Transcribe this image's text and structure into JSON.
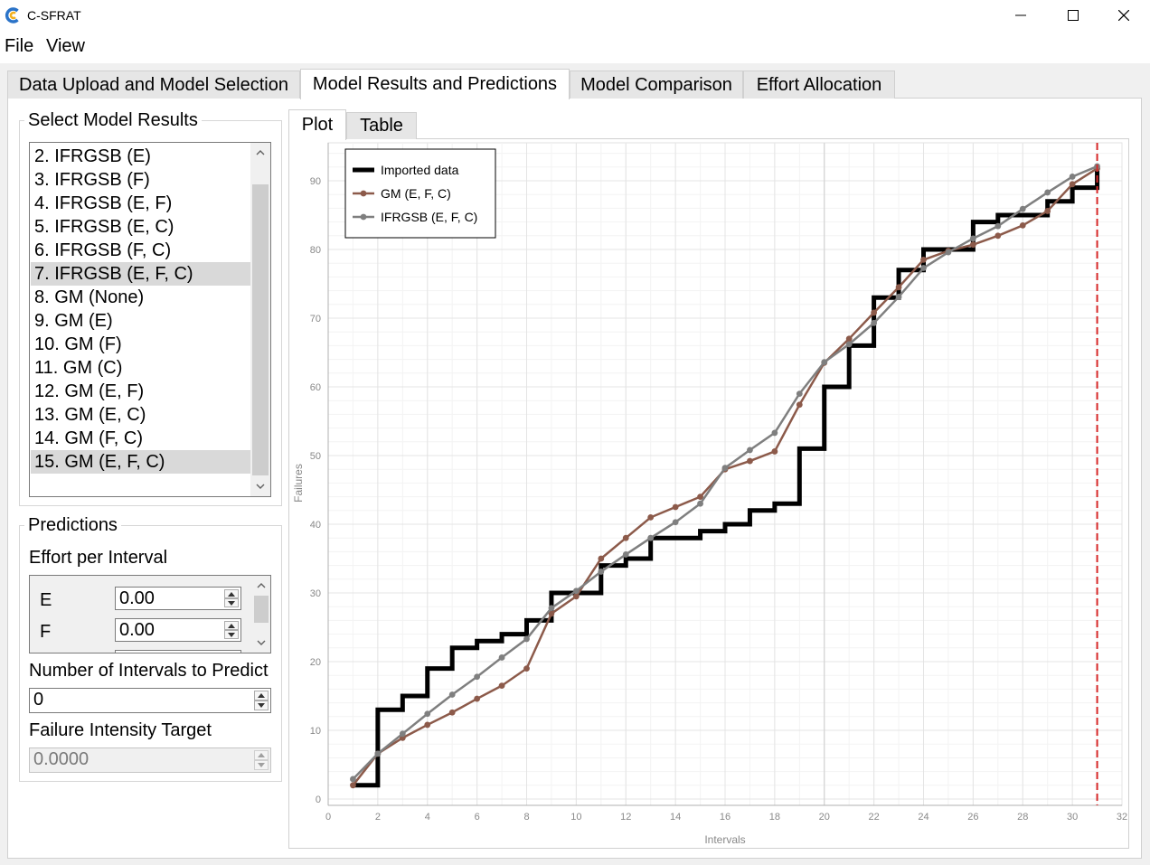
{
  "window": {
    "title": "C-SFRAT",
    "logo_colors": {
      "outer": "#2b73c8",
      "inner": "#f2b01e"
    }
  },
  "menu": {
    "file": "File",
    "view": "View"
  },
  "tabs": [
    {
      "label": "Data Upload and Model Selection",
      "active": false
    },
    {
      "label": "Model Results and Predictions",
      "active": true
    },
    {
      "label": "Model Comparison",
      "active": false
    },
    {
      "label": "Effort Allocation",
      "active": false
    }
  ],
  "model_results": {
    "title": "Select Model Results",
    "items": [
      {
        "label": "2. IFRGSB (E)",
        "selected": false
      },
      {
        "label": "3. IFRGSB (F)",
        "selected": false
      },
      {
        "label": "4. IFRGSB (E, F)",
        "selected": false
      },
      {
        "label": "5. IFRGSB (E, C)",
        "selected": false
      },
      {
        "label": "6. IFRGSB (F, C)",
        "selected": false
      },
      {
        "label": "7. IFRGSB (E, F, C)",
        "selected": true
      },
      {
        "label": "8. GM (None)",
        "selected": false
      },
      {
        "label": "9. GM (E)",
        "selected": false
      },
      {
        "label": "10. GM (F)",
        "selected": false
      },
      {
        "label": "11. GM (C)",
        "selected": false
      },
      {
        "label": "12. GM (E, F)",
        "selected": false
      },
      {
        "label": "13. GM (E, C)",
        "selected": false
      },
      {
        "label": "14. GM (F, C)",
        "selected": false
      },
      {
        "label": "15. GM (E, F, C)",
        "selected": true
      }
    ]
  },
  "predictions": {
    "title": "Predictions",
    "effort_label": "Effort per Interval",
    "effort_fields": [
      {
        "name": "E",
        "value": "0.00"
      },
      {
        "name": "F",
        "value": "0.00"
      }
    ],
    "intervals_label": "Number of Intervals to Predict",
    "intervals_value": "0",
    "target_label": "Failure Intensity Target",
    "target_value": "0.0000"
  },
  "plot_tabs": {
    "plot": "Plot",
    "table": "Table",
    "active": "Plot"
  },
  "chart_data": {
    "type": "line",
    "xlabel": "Intervals",
    "ylabel": "Failures",
    "xlim": [
      0,
      32
    ],
    "ylim": [
      0,
      95
    ],
    "xticks": [
      0,
      2,
      4,
      6,
      8,
      10,
      12,
      14,
      16,
      18,
      20,
      22,
      24,
      26,
      28,
      30,
      32
    ],
    "yticks": [
      0,
      10,
      20,
      30,
      40,
      50,
      60,
      70,
      80,
      90
    ],
    "grid": true,
    "legend_position": "top-left",
    "prediction_marker_x": 31,
    "series": [
      {
        "name": "Imported data",
        "style": "step",
        "color": "#000000",
        "x": [
          1,
          2,
          3,
          4,
          5,
          6,
          7,
          8,
          9,
          10,
          11,
          12,
          13,
          14,
          15,
          16,
          17,
          18,
          19,
          20,
          21,
          22,
          23,
          24,
          25,
          26,
          27,
          28,
          29,
          30,
          31
        ],
        "values": [
          2,
          13,
          15,
          19,
          22,
          23,
          24,
          26,
          30,
          30,
          34,
          35,
          38,
          38,
          39,
          40,
          42,
          43,
          51,
          60,
          66,
          73,
          77,
          80,
          80,
          84,
          85,
          85,
          87,
          89,
          92
        ]
      },
      {
        "name": "GM (E, F, C)",
        "style": "line-marker",
        "color": "#8c5a4a",
        "x": [
          1,
          2,
          3,
          4,
          5,
          6,
          7,
          8,
          9,
          10,
          11,
          12,
          13,
          14,
          15,
          16,
          17,
          18,
          19,
          20,
          21,
          22,
          23,
          24,
          25,
          26,
          27,
          28,
          29,
          30,
          31
        ],
        "values": [
          2,
          6.6,
          8.9,
          10.8,
          12.6,
          14.6,
          16.5,
          19,
          27,
          29.5,
          35,
          38,
          41,
          42.5,
          44,
          48,
          49.2,
          50.6,
          57.4,
          63.5,
          67,
          70.8,
          74.5,
          78.5,
          79.8,
          80.7,
          82,
          83.5,
          85.6,
          89.5,
          91.8
        ]
      },
      {
        "name": "IFRGSB (E, F, C)",
        "style": "line-marker",
        "color": "#7f7f7f",
        "x": [
          1,
          2,
          3,
          4,
          5,
          6,
          7,
          8,
          9,
          10,
          11,
          12,
          13,
          14,
          15,
          16,
          17,
          18,
          19,
          20,
          21,
          22,
          23,
          24,
          25,
          26,
          27,
          28,
          29,
          30,
          31
        ],
        "values": [
          2.9,
          6.6,
          9.5,
          12.4,
          15.2,
          17.8,
          20.6,
          23.3,
          27.8,
          30.3,
          33.1,
          35.6,
          38,
          40.3,
          43,
          48.2,
          50.8,
          53.3,
          59,
          63.6,
          66.2,
          69.3,
          73.1,
          77.3,
          79.6,
          81.6,
          83.4,
          85.9,
          88.3,
          90.6,
          92.1
        ]
      }
    ]
  }
}
